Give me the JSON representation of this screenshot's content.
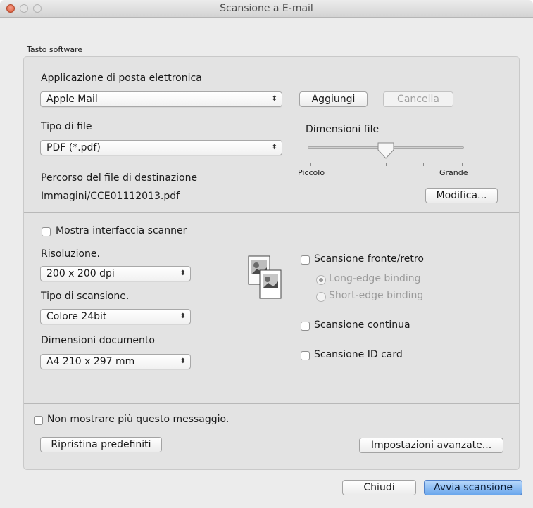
{
  "window": {
    "title": "Scansione a E-mail"
  },
  "group": {
    "label": "Tasto software"
  },
  "email": {
    "label": "Applicazione di posta elettronica",
    "app_value": "Apple Mail",
    "add_button": "Aggiungi",
    "delete_button": "Cancella"
  },
  "file_type": {
    "label": "Tipo di file",
    "value": "PDF (*.pdf)"
  },
  "file_size": {
    "label": "Dimensioni file",
    "min_label": "Piccolo",
    "max_label": "Grande",
    "level": 0.5
  },
  "destination": {
    "label": "Percorso del file di destinazione",
    "path": "Immagini/CCE01112013.pdf",
    "modify_button": "Modifica..."
  },
  "scan": {
    "show_interface": "Mostra interfaccia scanner",
    "resolution_label": "Risoluzione.",
    "resolution_value": "200 x 200 dpi",
    "scan_type_label": "Tipo di scansione.",
    "scan_type_value": "Colore 24bit",
    "doc_size_label": "Dimensioni documento",
    "doc_size_value": "A4 210 x 297 mm",
    "duplex_label": "Scansione fronte/retro",
    "long_edge": "Long-edge binding",
    "short_edge": "Short-edge binding",
    "continuous_label": "Scansione continua",
    "id_card_label": "Scansione ID card"
  },
  "footer": {
    "dont_show": "Non mostrare più questo messaggio.",
    "restore_button": "Ripristina predefiniti",
    "advanced_button": "Impostazioni avanzate...",
    "close_button": "Chiudi",
    "start_button": "Avvia scansione"
  },
  "colors": {
    "primary_button": "#6aa6ec",
    "close_light": "#d9542f"
  },
  "icons": {
    "popup_arrows": "up-down-arrows",
    "document": "duplex-document-icon"
  }
}
